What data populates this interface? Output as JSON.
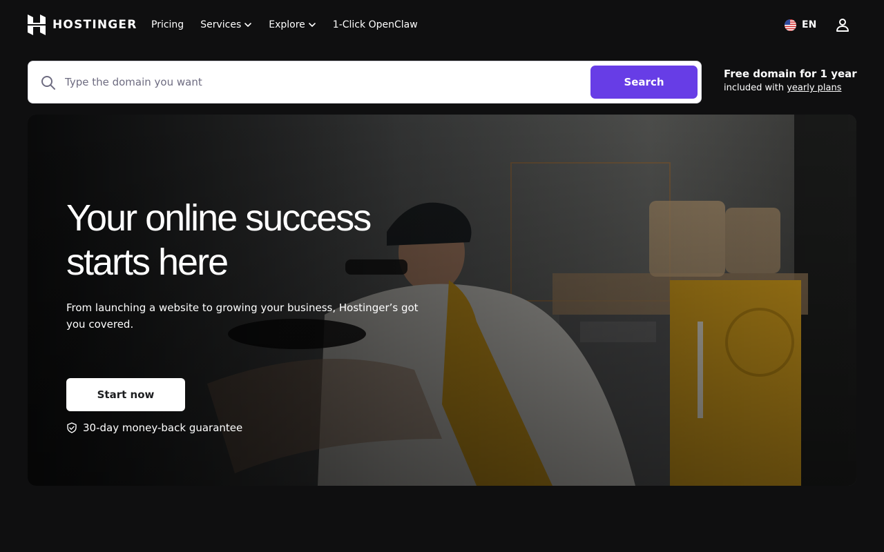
{
  "brand": {
    "name": "HOSTINGER"
  },
  "nav": {
    "items": [
      {
        "label": "Pricing",
        "has_dropdown": false
      },
      {
        "label": "Services",
        "has_dropdown": true
      },
      {
        "label": "Explore",
        "has_dropdown": true
      },
      {
        "label": "1-Click OpenClaw",
        "has_dropdown": false
      }
    ],
    "language": "EN",
    "language_icon": "us-flag-icon",
    "account_icon": "user-icon"
  },
  "search": {
    "placeholder": "Type the domain you want",
    "value": "",
    "button_label": "Search",
    "icon": "search-icon"
  },
  "promo": {
    "title": "Free domain for 1 year",
    "subtitle_prefix": "included with ",
    "subtitle_link": "yearly plans"
  },
  "hero": {
    "title_line1": "Your online success",
    "title_line2": "starts here",
    "subtitle": "From launching a website to growing your business, Hostinger’s got you covered.",
    "cta_label": "Start now",
    "guarantee": "30-day money-back guarantee",
    "guarantee_icon": "shield-check-icon"
  },
  "colors": {
    "page_bg": "#0f0f10",
    "accent": "#673de6",
    "hero_apron": "#d9a21d",
    "text": "#ffffff"
  }
}
